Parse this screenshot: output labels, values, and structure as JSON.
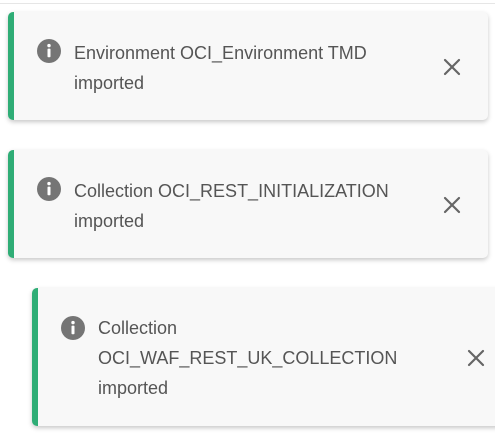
{
  "colors": {
    "accent": "#2fad76",
    "background": "#f8f8f8",
    "text": "#555555",
    "icon": "#757575"
  },
  "notifications": [
    {
      "type": "info",
      "icon": "info-icon",
      "lines": [
        "Environment OCI_Environment TMD",
        "imported"
      ],
      "close_icon": "close-icon"
    },
    {
      "type": "info",
      "icon": "info-icon",
      "lines": [
        "Collection OCI_REST_INITIALIZATION",
        "imported"
      ],
      "close_icon": "close-icon"
    },
    {
      "type": "info",
      "icon": "info-icon",
      "lines": [
        "Collection",
        "OCI_WAF_REST_UK_COLLECTION",
        "imported"
      ],
      "close_icon": "close-icon"
    }
  ]
}
